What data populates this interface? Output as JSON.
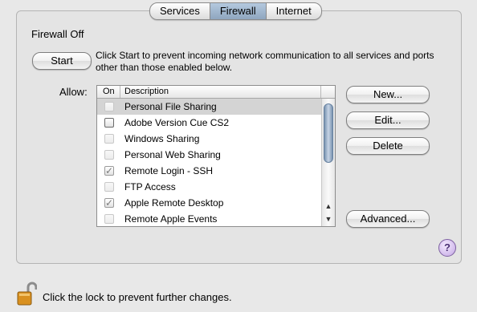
{
  "tabs": [
    {
      "label": "Services",
      "active": false
    },
    {
      "label": "Firewall",
      "active": true
    },
    {
      "label": "Internet",
      "active": false
    }
  ],
  "firewall": {
    "status": "Firewall Off",
    "start_label": "Start",
    "description": "Click Start to prevent incoming network communication to all services and ports other than those enabled below."
  },
  "allow": {
    "label": "Allow:",
    "columns": {
      "on": "On",
      "description": "Description"
    },
    "items": [
      {
        "label": "Personal File Sharing",
        "checked": false,
        "selected": true
      },
      {
        "label": "Adobe Version Cue CS2",
        "checked": false,
        "selected": false
      },
      {
        "label": "Windows Sharing",
        "checked": false,
        "selected": false
      },
      {
        "label": "Personal Web Sharing",
        "checked": false,
        "selected": false
      },
      {
        "label": "Remote Login - SSH",
        "checked": true,
        "selected": false
      },
      {
        "label": "FTP Access",
        "checked": false,
        "selected": false
      },
      {
        "label": "Apple Remote Desktop",
        "checked": true,
        "selected": false
      },
      {
        "label": "Remote Apple Events",
        "checked": false,
        "selected": false
      }
    ]
  },
  "buttons": {
    "new": "New...",
    "edit": "Edit...",
    "delete": "Delete",
    "advanced": "Advanced..."
  },
  "help": {
    "glyph": "?"
  },
  "lock": {
    "text": "Click the lock to prevent further changes.",
    "icon": "unlocked-padlock-icon"
  }
}
